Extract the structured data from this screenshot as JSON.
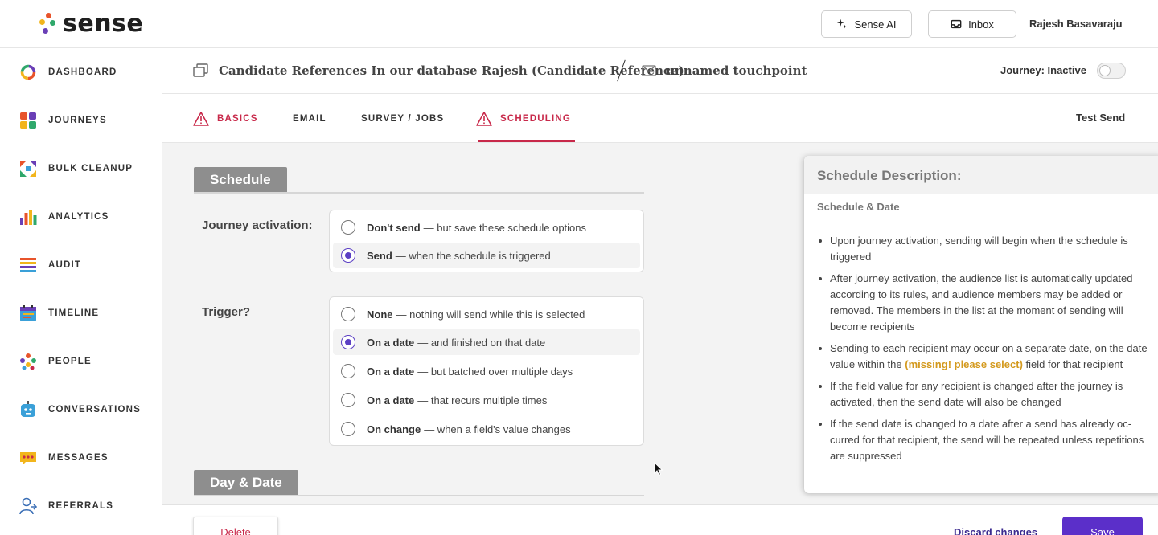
{
  "app": {
    "logo_text": "sense"
  },
  "topbar": {
    "sense_ai_label": "Sense AI",
    "inbox_label": "Inbox",
    "user_name": "Rajesh Basavaraju"
  },
  "sidebar": {
    "items": [
      {
        "label": "DASHBOARD",
        "icon": "dashboard-ring-icon"
      },
      {
        "label": "JOURNEYS",
        "icon": "journeys-grid-icon"
      },
      {
        "label": "BULK CLEANUP",
        "icon": "bulk-cleanup-icon"
      },
      {
        "label": "ANALYTICS",
        "icon": "analytics-bars-icon"
      },
      {
        "label": "AUDIT",
        "icon": "audit-list-icon"
      },
      {
        "label": "TIMELINE",
        "icon": "timeline-calendar-icon"
      },
      {
        "label": "PEOPLE",
        "icon": "people-icon"
      },
      {
        "label": "CONVERSATIONS",
        "icon": "conversations-bot-icon"
      },
      {
        "label": "MESSAGES",
        "icon": "messages-bubble-icon"
      },
      {
        "label": "REFERRALS",
        "icon": "referrals-user-icon"
      }
    ]
  },
  "header": {
    "journey_name": "Candidate References In our database Rajesh (Candidate Reference)",
    "touchpoint_name": "unnamed touchpoint",
    "journey_status_label": "Journey: Inactive"
  },
  "tabs": {
    "items": [
      {
        "label": "BASICS",
        "warning": true
      },
      {
        "label": "EMAIL",
        "warning": false
      },
      {
        "label": "SURVEY / JOBS",
        "warning": false
      },
      {
        "label": "SCHEDULING",
        "warning": true,
        "active": true
      }
    ],
    "test_send_label": "Test Send"
  },
  "schedule": {
    "section_title": "Schedule",
    "activation_label": "Journey activation:",
    "activation_options": [
      {
        "bold": "Don't send",
        "rest": "— but save these schedule options",
        "selected": false
      },
      {
        "bold": "Send",
        "rest": "— when the schedule is triggered",
        "selected": true
      }
    ],
    "trigger_label": "Trigger?",
    "trigger_options": [
      {
        "bold": "None",
        "rest": "— nothing will send while this is selected",
        "selected": false
      },
      {
        "bold": "On a date",
        "rest": "— and finished on that date",
        "selected": true
      },
      {
        "bold": "On a date",
        "rest": "— but batched over multiple days",
        "selected": false
      },
      {
        "bold": "On a date",
        "rest": "— that recurs multiple times",
        "selected": false
      },
      {
        "bold": "On change",
        "rest": "— when a field's value changes",
        "selected": false
      }
    ],
    "day_date_title": "Day & Date"
  },
  "description": {
    "title": "Schedule Description:",
    "subtitle": "Schedule & Date",
    "bullets": [
      "Upon journey activation, sending will begin when the schedule is triggered",
      "After journey activation, the audience list is automatically updated according to its rules, and audience members may be added or removed. The members in the list at the moment of sending will become recipients",
      {
        "before": "Sending to each recipient may occur on a separate date, on the date value within the ",
        "highlight": "(missing! please select)",
        "after": " field for that recipient"
      },
      "If the field value for any recipient is changed after the journey is activated, then the send date will also be changed",
      "If the send date is changed to a date after a send has already oc­curred for that recipient, the send will be repeated unless repeti­tions are suppressed"
    ],
    "highlight_color": "#d49a1e"
  },
  "footer": {
    "delete_label": "Delete",
    "discard_label": "Discard changes",
    "save_label": "Save"
  },
  "colors": {
    "accent": "#5b2fc9",
    "warning": "#c8294a"
  }
}
